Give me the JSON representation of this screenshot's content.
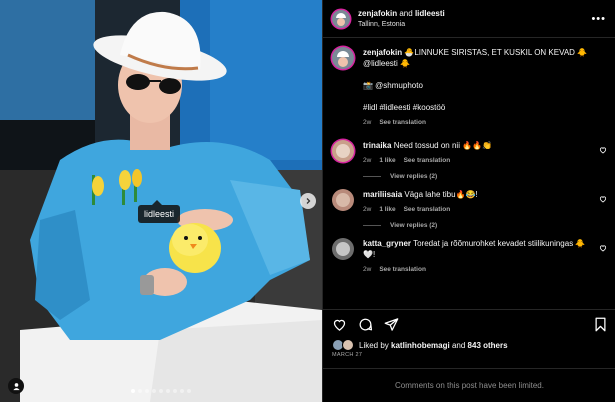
{
  "post": {
    "header": {
      "author": "zenjafokin",
      "joiner": "and",
      "collaborator": "lidleesti",
      "location": "Tallinn, Estonia",
      "more_icon": "more-horizontal-icon"
    },
    "photo": {
      "tag_label": "lidleesti",
      "dots_total": 9,
      "dots_active_index": 0
    },
    "caption": {
      "username": "zenjafokin",
      "line1": "🐣LINNUKE SIRISTAS, ET KUSKIL ON KEVAD 🐥",
      "line2": "@lidleesti 🐥",
      "line3": "📸 @shmuphoto",
      "line4": "#lidl #lidleesti #koostöö",
      "time": "2w",
      "translate": "See translation"
    },
    "comments": [
      {
        "username": "trinaika",
        "text": "Need tossud on nii 🔥🔥👏",
        "time": "2w",
        "likes": "1 like",
        "translate": "See translation",
        "view_replies": "View replies (2)"
      },
      {
        "username": "mariliisaia",
        "text": "Väga lahe tibu🔥😂!",
        "time": "2w",
        "likes": "1 like",
        "translate": "See translation",
        "view_replies": "View replies (2)"
      },
      {
        "username": "katta_gryner",
        "text": "Toredat ja rõõmurohket kevadet stiilikuningas 🐥🤍!",
        "time": "2w",
        "likes": "",
        "translate": "See translation",
        "view_replies": ""
      }
    ],
    "likes": {
      "prefix": "Liked by",
      "user": "katlinhobemagi",
      "joiner": "and",
      "others": "843 others"
    },
    "date": "MARCH 27",
    "comments_limited": "Comments on this post have been limited.",
    "colors": {
      "background": "#000000",
      "text": "#f5f5f5",
      "secondary": "#a8a8a8",
      "border": "#262626",
      "story_ring": "#d6249f"
    }
  }
}
